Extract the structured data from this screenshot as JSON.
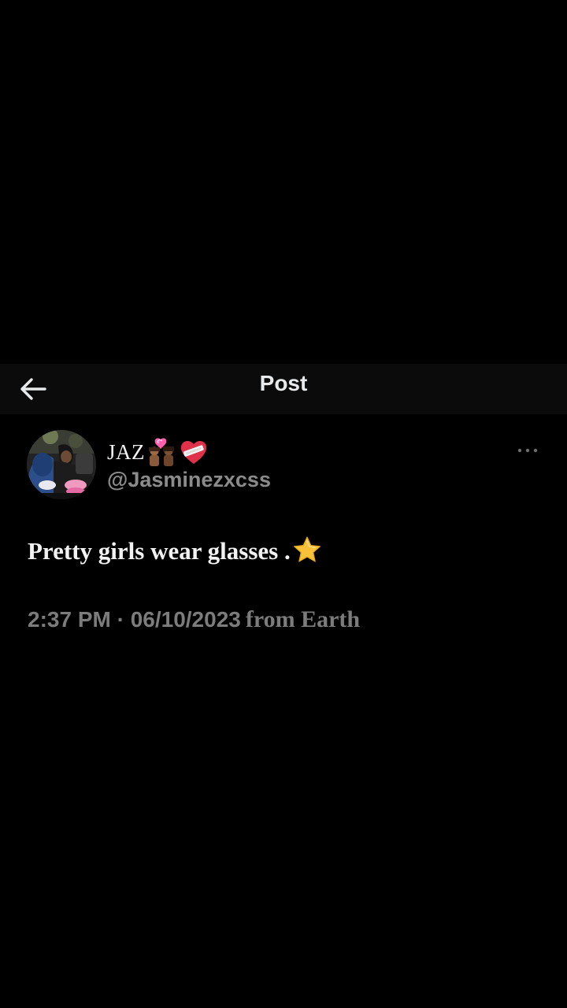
{
  "header": {
    "title": "Post",
    "back_icon": "arrow-left-icon"
  },
  "post": {
    "author": {
      "display_name": "JAZ",
      "name_emojis": [
        "couple-with-heart-icon",
        "mending-heart-icon"
      ],
      "handle": "@Jasminezxcss",
      "avatar": "profile-photo"
    },
    "more_icon": "ellipsis-icon",
    "text": "Pretty girls wear glasses .",
    "text_emoji": "star-icon",
    "timestamp": "2:37 PM · 06/10/2023",
    "location": "from Earth"
  },
  "colors": {
    "background": "#000000",
    "header_background": "#0b0b0b",
    "primary_text": "#f2f2f2",
    "secondary_text": "#8b8b8b",
    "meta_text": "#7c7c7c",
    "star": "#f7c23a",
    "heart_pink": "#ff5fae",
    "heart_red": "#e0314b"
  }
}
